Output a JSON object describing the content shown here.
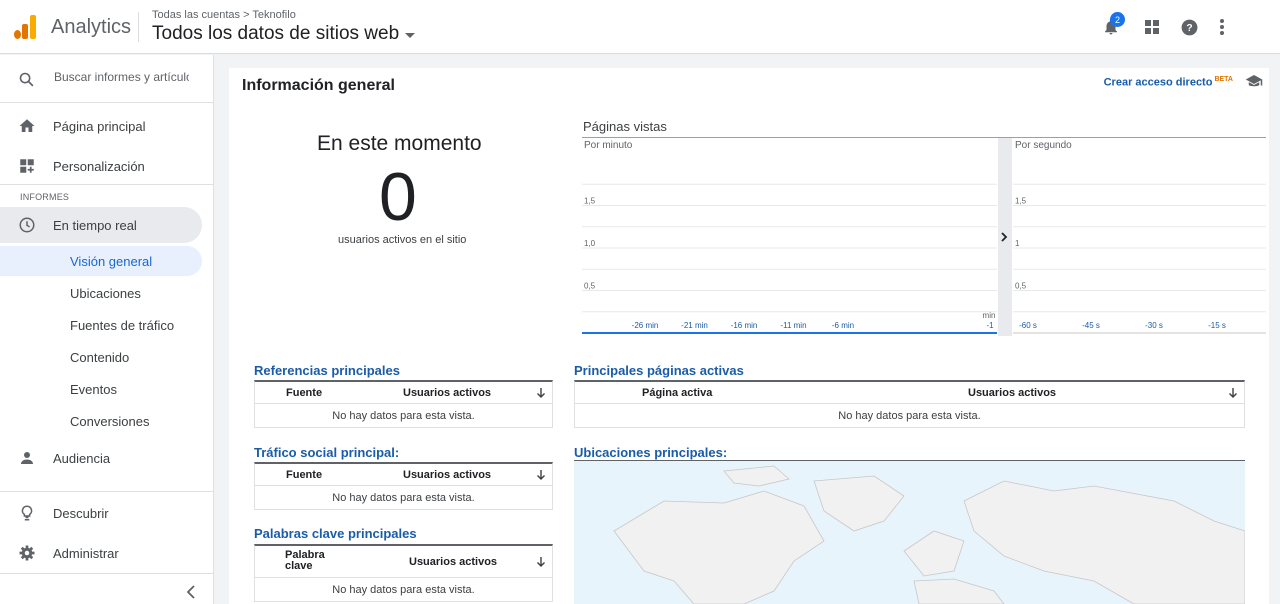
{
  "app": {
    "name": "Analytics"
  },
  "header": {
    "breadcrumb": "Todas las cuentas > Teknofilo",
    "property": "Todos los datos de sitios web",
    "notifications_count": "2",
    "icons": [
      "bell-icon",
      "apps-grid-icon",
      "help-icon",
      "more-vert-icon"
    ]
  },
  "sidebar": {
    "search_placeholder": "Buscar informes y artículos",
    "home": "Página principal",
    "customization": "Personalización",
    "reports_heading": "INFORMES",
    "realtime": "En tiempo real",
    "realtime_items": [
      "Visión general",
      "Ubicaciones",
      "Fuentes de tráfico",
      "Contenido",
      "Eventos",
      "Conversiones"
    ],
    "audience": "Audiencia",
    "discover": "Descubrir",
    "admin": "Administrar"
  },
  "main": {
    "title": "Información general",
    "shortcut_label": "Crear acceso directo",
    "beta_label": "BETA",
    "now_title": "En este momento",
    "active_users_value": "0",
    "active_users_label": "usuarios activos en el sitio",
    "pageviews_title": "Páginas vistas",
    "empty_text": "No hay datos para esta vista.",
    "top_referrals": {
      "title": "Referencias principales",
      "col1": "Fuente",
      "col2": "Usuarios activos"
    },
    "top_social": {
      "title": "Tráfico social principal:",
      "col1": "Fuente",
      "col2": "Usuarios activos"
    },
    "top_keywords": {
      "title": "Palabras clave principales",
      "col1": "Palabra clave",
      "col2": "Usuarios activos"
    },
    "top_pages": {
      "title": "Principales páginas activas",
      "col1": "Página activa",
      "col2": "Usuarios activos"
    },
    "top_locations": {
      "title": "Ubicaciones principales:"
    }
  },
  "accent_color": "#1a73e8",
  "chart_data": [
    {
      "type": "bar",
      "title": "Por minuto",
      "xlabel": "min",
      "categories": [
        "-26 min",
        "-21 min",
        "-16 min",
        "-11 min",
        "-6 min",
        "-1"
      ],
      "values": [
        0,
        0,
        0,
        0,
        0,
        0
      ],
      "y_ticks": [
        "0,5",
        "1,0",
        "1,5"
      ],
      "ylim": [
        0,
        2
      ]
    },
    {
      "type": "bar",
      "title": "Por segundo",
      "categories": [
        "-60 s",
        "-45 s",
        "-30 s",
        "-15 s"
      ],
      "values": [
        0,
        0,
        0,
        0
      ],
      "y_ticks": [
        "0,5",
        "1",
        "1,5"
      ],
      "ylim": [
        0,
        2
      ]
    }
  ]
}
